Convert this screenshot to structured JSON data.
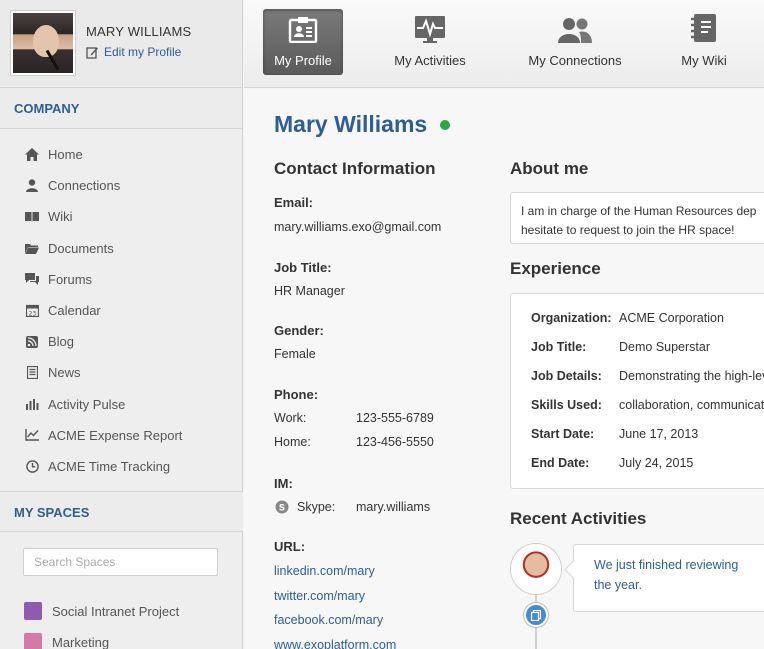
{
  "user": {
    "name": "MARY WILLIAMS",
    "edit_label": "Edit my Profile"
  },
  "company": {
    "heading": "COMPANY",
    "items": [
      {
        "label": "Home",
        "icon": "home-icon"
      },
      {
        "label": "Connections",
        "icon": "person-icon"
      },
      {
        "label": "Wiki",
        "icon": "book-icon"
      },
      {
        "label": "Documents",
        "icon": "folder-icon"
      },
      {
        "label": "Forums",
        "icon": "chat-icon"
      },
      {
        "label": "Calendar",
        "icon": "calendar-icon"
      },
      {
        "label": "Blog",
        "icon": "rss-icon"
      },
      {
        "label": "News",
        "icon": "news-icon"
      },
      {
        "label": "Activity Pulse",
        "icon": "bar-chart-icon"
      },
      {
        "label": "ACME Expense Report",
        "icon": "line-chart-icon"
      },
      {
        "label": "ACME Time Tracking",
        "icon": "clock-icon"
      }
    ]
  },
  "spaces": {
    "heading": "MY SPACES",
    "search_placeholder": "Search Spaces",
    "items": [
      {
        "label": "Social Intranet Project",
        "color": "#8e44ad"
      },
      {
        "label": "Marketing",
        "color": "#c0392b"
      }
    ]
  },
  "tabs": [
    {
      "label": "My Profile",
      "icon": "profile-card-icon",
      "active": true
    },
    {
      "label": "My Activities",
      "icon": "activity-icon",
      "active": false
    },
    {
      "label": "My Connections",
      "icon": "people-icon",
      "active": false
    },
    {
      "label": "My Wiki",
      "icon": "notebook-icon",
      "active": false
    }
  ],
  "profile": {
    "name": "Mary Williams",
    "status_color": "#2aa844",
    "contact_heading": "Contact Information",
    "email_label": "Email:",
    "email": "mary.williams.exo@gmail.com",
    "job_title_label": "Job Title:",
    "job_title": "HR Manager",
    "gender_label": "Gender:",
    "gender": "Female",
    "phone_label": "Phone:",
    "phone_work_label": "Work:",
    "phone_work": "123-555-6789",
    "phone_home_label": "Home:",
    "phone_home": "123-456-5550",
    "im_label": "IM:",
    "im_type": "Skype:",
    "im_value": "mary.williams",
    "url_label": "URL:",
    "urls": [
      "linkedin.com/mary",
      "twitter.com/mary",
      "facebook.com/mary",
      "www.exoplatform.com"
    ]
  },
  "about": {
    "heading": "About me",
    "line1": "I am in charge of the Human Resources dep",
    "line2": "hesitate to request to join the HR space!"
  },
  "experience": {
    "heading": "Experience",
    "rows": [
      {
        "k": "Organization:",
        "v": "ACME Corporation"
      },
      {
        "k": "Job Title:",
        "v": "Demo Superstar"
      },
      {
        "k": "Job Details:",
        "v": "Demonstrating the high-lev"
      },
      {
        "k": "Skills Used:",
        "v": "collaboration, communicat"
      },
      {
        "k": "Start Date:",
        "v": "June 17, 2013"
      },
      {
        "k": "End Date:",
        "v": "July 24, 2015"
      }
    ]
  },
  "recent": {
    "heading": "Recent Activities",
    "activity_text": "We just finished reviewing the year."
  }
}
